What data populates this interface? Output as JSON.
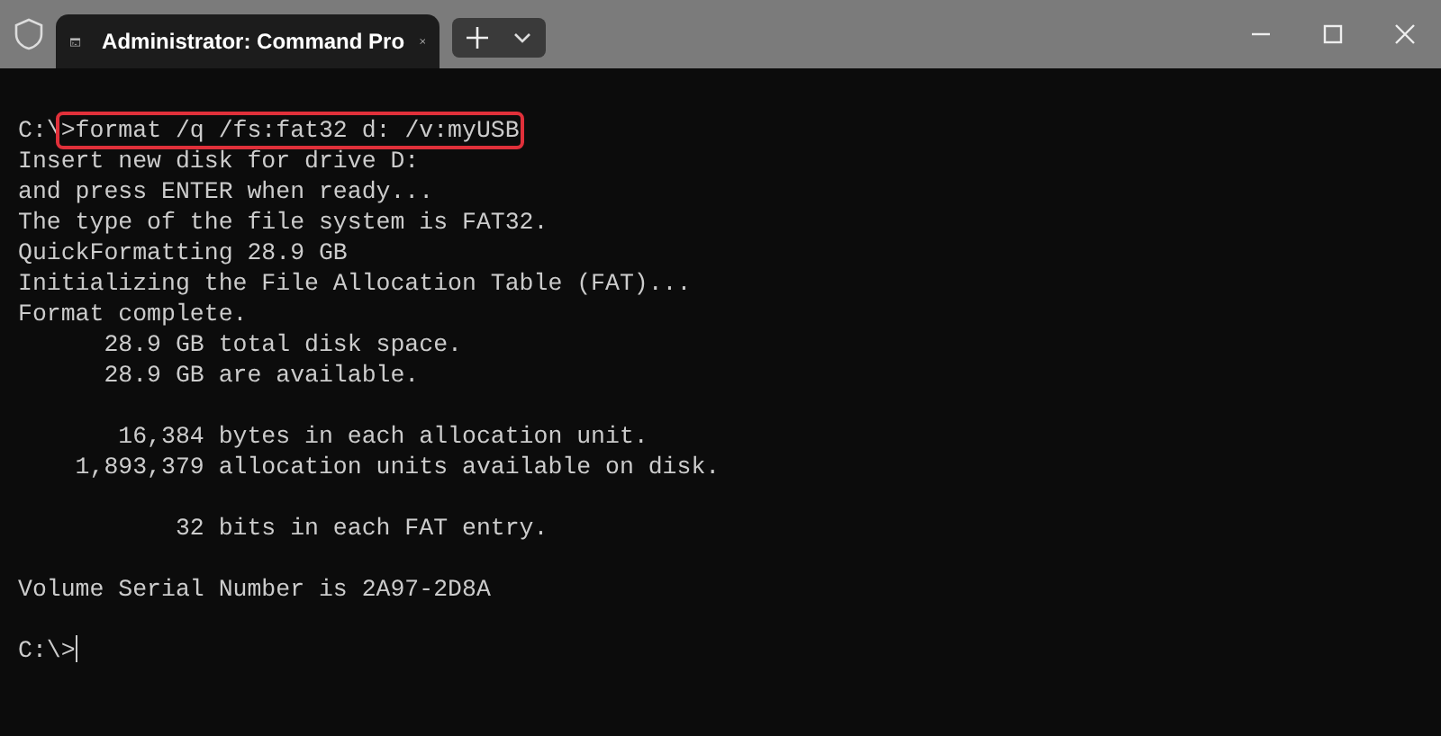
{
  "tab": {
    "title": "Administrator: Command Pro",
    "selected": true
  },
  "lines": [
    {
      "kind": "command",
      "prompt": "C:\\",
      "text": ">format /q /fs:fat32 d: /v:myUSB",
      "highlighted": true
    },
    {
      "kind": "output",
      "text": "Insert new disk for drive D:"
    },
    {
      "kind": "output",
      "text": "and press ENTER when ready..."
    },
    {
      "kind": "output",
      "text": "The type of the file system is FAT32."
    },
    {
      "kind": "output",
      "text": "QuickFormatting 28.9 GB"
    },
    {
      "kind": "output",
      "text": "Initializing the File Allocation Table (FAT)..."
    },
    {
      "kind": "output",
      "text": "Format complete."
    },
    {
      "kind": "output",
      "text": "      28.9 GB total disk space."
    },
    {
      "kind": "output",
      "text": "      28.9 GB are available."
    },
    {
      "kind": "blank"
    },
    {
      "kind": "output",
      "text": "       16,384 bytes in each allocation unit."
    },
    {
      "kind": "output",
      "text": "    1,893,379 allocation units available on disk."
    },
    {
      "kind": "blank"
    },
    {
      "kind": "output",
      "text": "           32 bits in each FAT entry."
    },
    {
      "kind": "blank"
    },
    {
      "kind": "output",
      "text": "Volume Serial Number is 2A97-2D8A"
    },
    {
      "kind": "blank"
    },
    {
      "kind": "prompt",
      "text": "C:\\>",
      "cursor": true
    }
  ]
}
